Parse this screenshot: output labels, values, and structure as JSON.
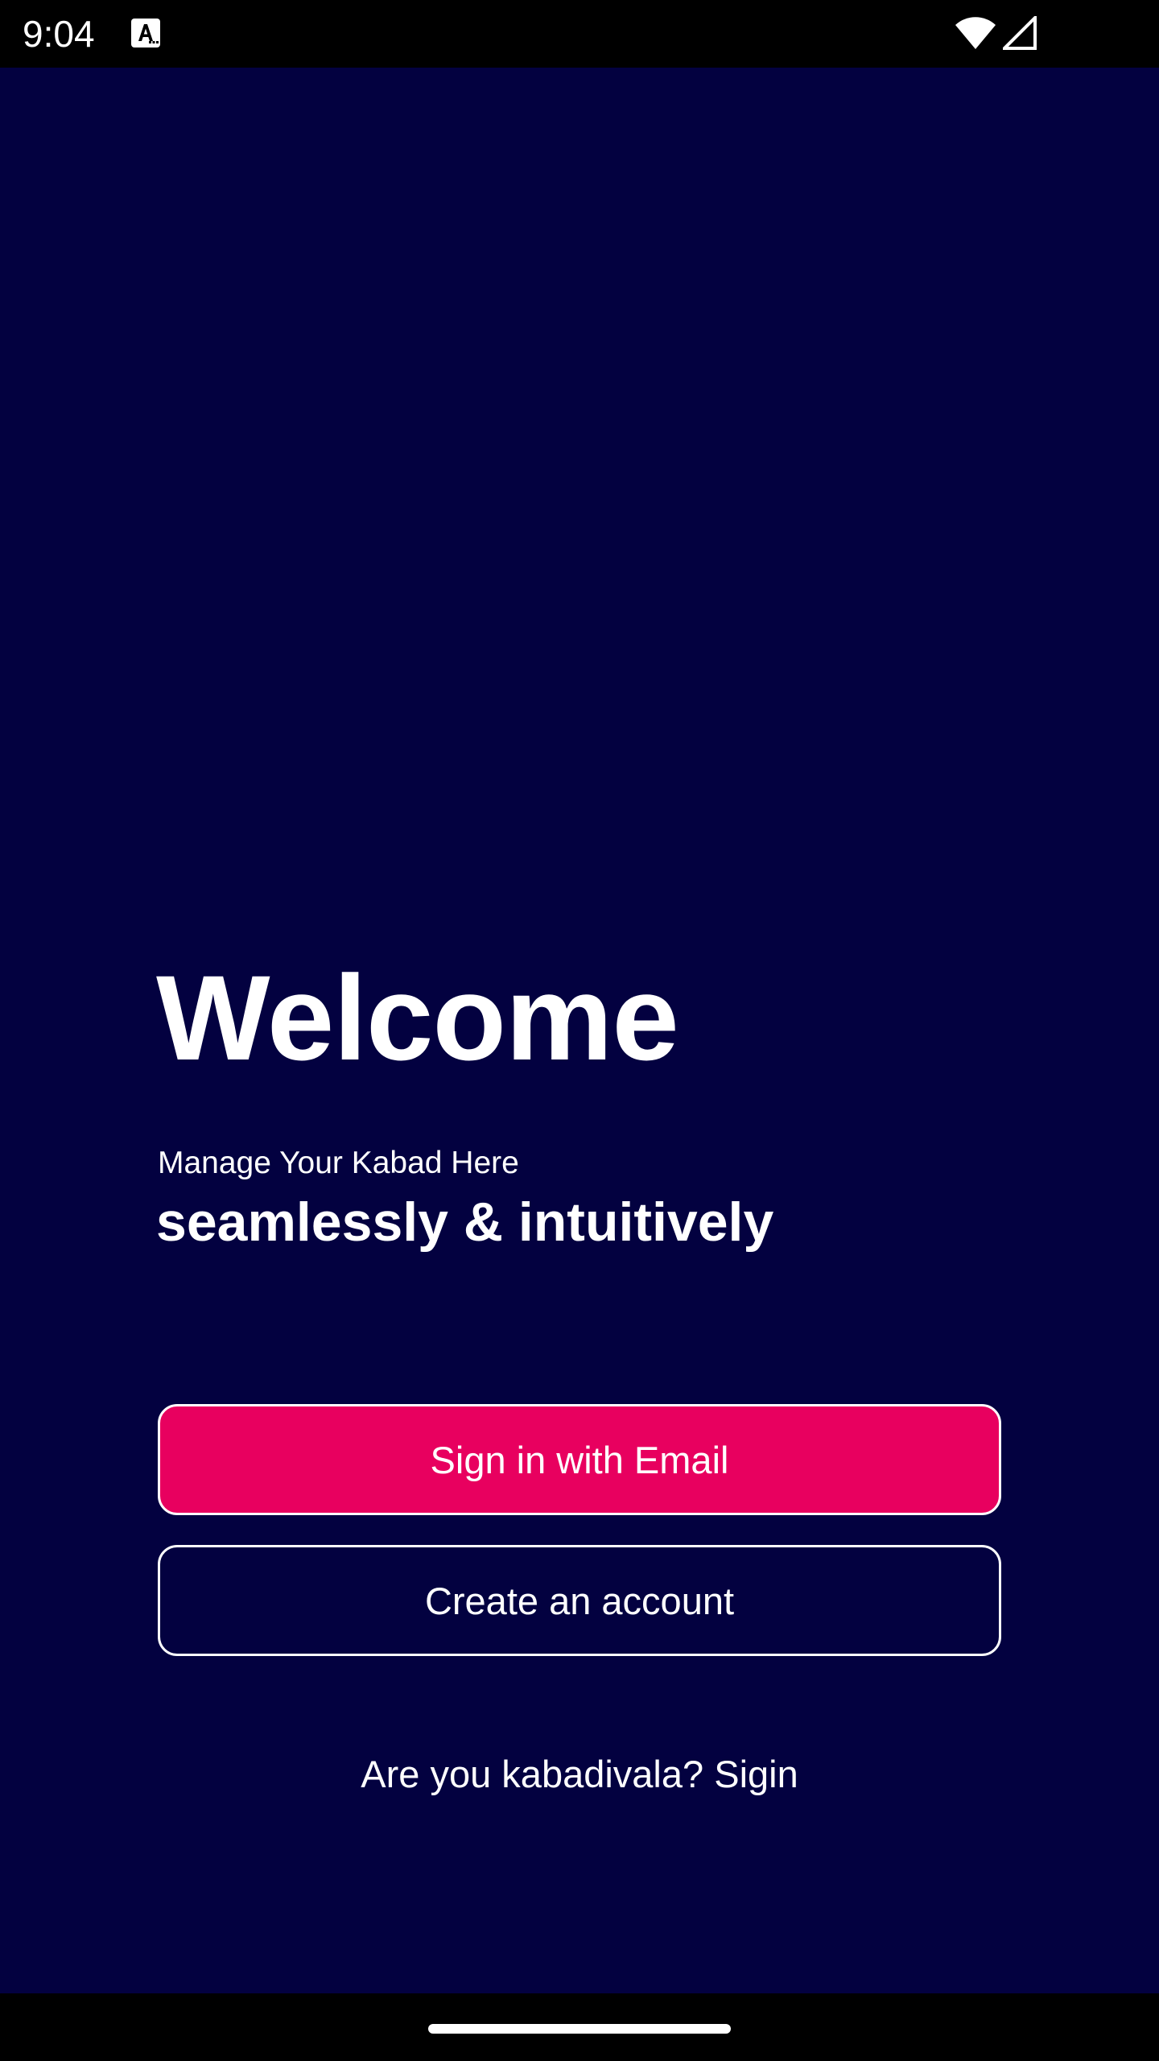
{
  "status_bar": {
    "time": "9:04",
    "notification_icon": "font-a-icon",
    "wifi_icon": "wifi-icon",
    "signal_icon": "cell-signal-icon"
  },
  "colors": {
    "background": "#030140",
    "primary_button": "#e8005f",
    "text": "#ffffff"
  },
  "welcome": {
    "title": "Welcome",
    "tagline_small": "Manage Your Kabad Here",
    "tagline_bold": "seamlessly & intuitively"
  },
  "actions": {
    "sign_in_email": "Sign in with Email",
    "create_account": "Create an account",
    "vendor_signin": "Are you kabadivala? Sigin"
  }
}
